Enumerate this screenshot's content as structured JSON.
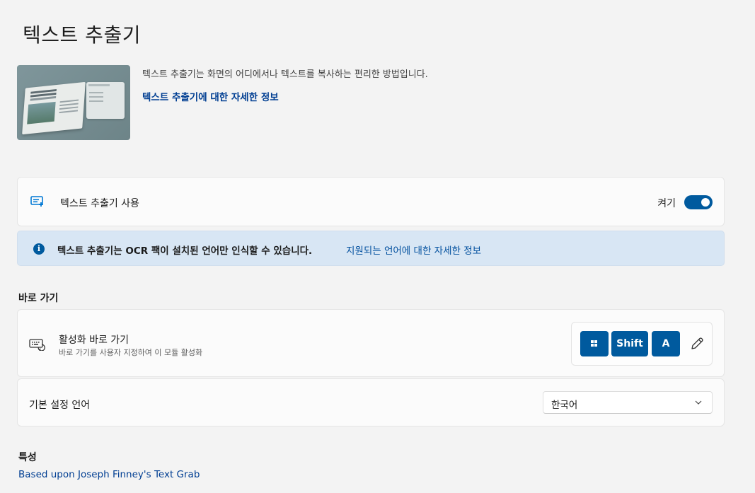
{
  "page": {
    "title": "텍스트 추출기"
  },
  "hero": {
    "description": "텍스트 추출기는 화면의 어디에서나 텍스트를 복사하는 편리한 방법입니다.",
    "learn_more_link": "텍스트 추출기에 대한 자세한 정보",
    "image_icon": "text-extractor-preview-illustration"
  },
  "enable_card": {
    "icon": "text-extractor-app-icon",
    "label": "텍스트 추출기 사용",
    "state_label": "켜기",
    "toggle_on": true
  },
  "info_bar": {
    "icon": "info-icon",
    "message": "텍스트 추출기는 OCR 팩이 설치된 언어만 인식할 수 있습니다.",
    "link": "지원되는 언어에 대한 자세한 정보"
  },
  "shortcut_section": {
    "heading": "바로 가기",
    "card": {
      "icon": "keyboard-icon",
      "title": "활성화 바로 가기",
      "subtitle": "바로 가기를 사용자 지정하여 이 모듈 활성화",
      "keys": {
        "win_icon": "windows-logo-icon",
        "shift": "Shift",
        "letter": "A"
      },
      "edit_icon": "pencil-edit-icon"
    }
  },
  "language_card": {
    "label": "기본 설정 언어",
    "selected": "한국어",
    "chevron_icon": "chevron-down-icon"
  },
  "attribution_section": {
    "heading": "특성",
    "link": "Based upon Joseph Finney's Text Grab"
  },
  "colors": {
    "accent": "#005a9e",
    "link": "#003e92",
    "info_background": "#d8e6f4",
    "page_background": "#f3f3f3"
  }
}
